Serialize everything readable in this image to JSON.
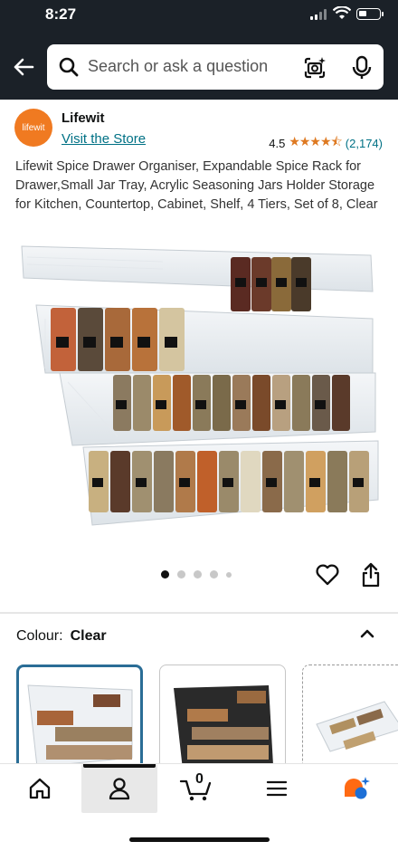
{
  "status_bar": {
    "time": "8:27"
  },
  "search": {
    "placeholder": "Search or ask a question"
  },
  "seller": {
    "logo_text": "lifewit",
    "name": "Lifewit",
    "store_link": "Visit the Store"
  },
  "rating": {
    "score": "4.5",
    "stars": 4.5,
    "count": "(2,174)",
    "star_color": "#de7921"
  },
  "product": {
    "title": "Lifewit Spice Drawer Organiser, Expandable Spice Rack for Drawer,Small Jar Tray, Acrylic Seasoning Jars Holder Storage for Kitchen, Countertop, Cabinet, Shelf, 4 Tiers, Set of 8, Clear",
    "image_count": 5,
    "active_image": 1
  },
  "variant": {
    "label": "Colour:",
    "selected": "Clear"
  },
  "swatches": [
    {
      "name": "clear",
      "selected": true
    },
    {
      "name": "black",
      "selected": false
    },
    {
      "name": "clear-alt",
      "selected": false
    }
  ],
  "nav": {
    "items": [
      "home-icon",
      "account-icon",
      "cart-icon",
      "menu-icon",
      "rufus-icon"
    ],
    "active": "account-icon",
    "cart_count": "0"
  },
  "colors": {
    "header": "#1b2128",
    "link": "#007185",
    "selected_swatch_border": "#2a6d96"
  }
}
